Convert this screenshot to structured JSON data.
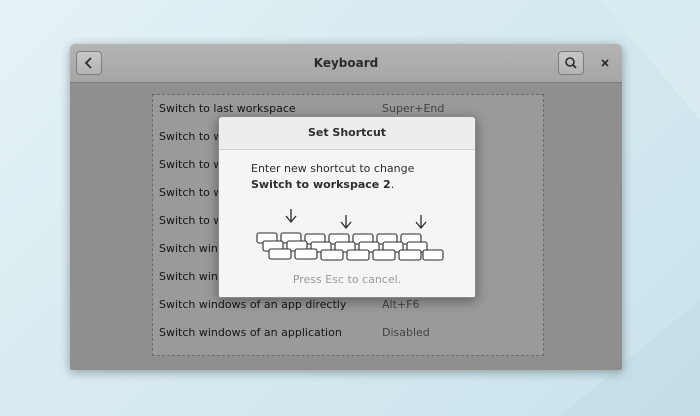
{
  "window": {
    "title": "Keyboard"
  },
  "shortcuts": [
    {
      "label": "Switch to last workspace",
      "value": "Super+End"
    },
    {
      "label": "Switch to wo",
      "value": ""
    },
    {
      "label": "Switch to wo",
      "value": ""
    },
    {
      "label": "Switch to wo",
      "value": ""
    },
    {
      "label": "Switch to wo",
      "value": ""
    },
    {
      "label": "Switch windo",
      "value": ""
    },
    {
      "label": "Switch windo",
      "value": ""
    },
    {
      "label": "Switch windows of an app directly",
      "value": "Alt+F6"
    },
    {
      "label": "Switch windows of an application",
      "value": "Disabled"
    }
  ],
  "dialog": {
    "title": "Set Shortcut",
    "message_prefix": "Enter new shortcut to change ",
    "message_target": "Switch to workspace 2",
    "message_suffix": ".",
    "cancel_hint": "Press Esc to cancel."
  },
  "icons": {
    "back": "chevron-left-icon",
    "search": "search-icon",
    "close": "close-icon"
  }
}
